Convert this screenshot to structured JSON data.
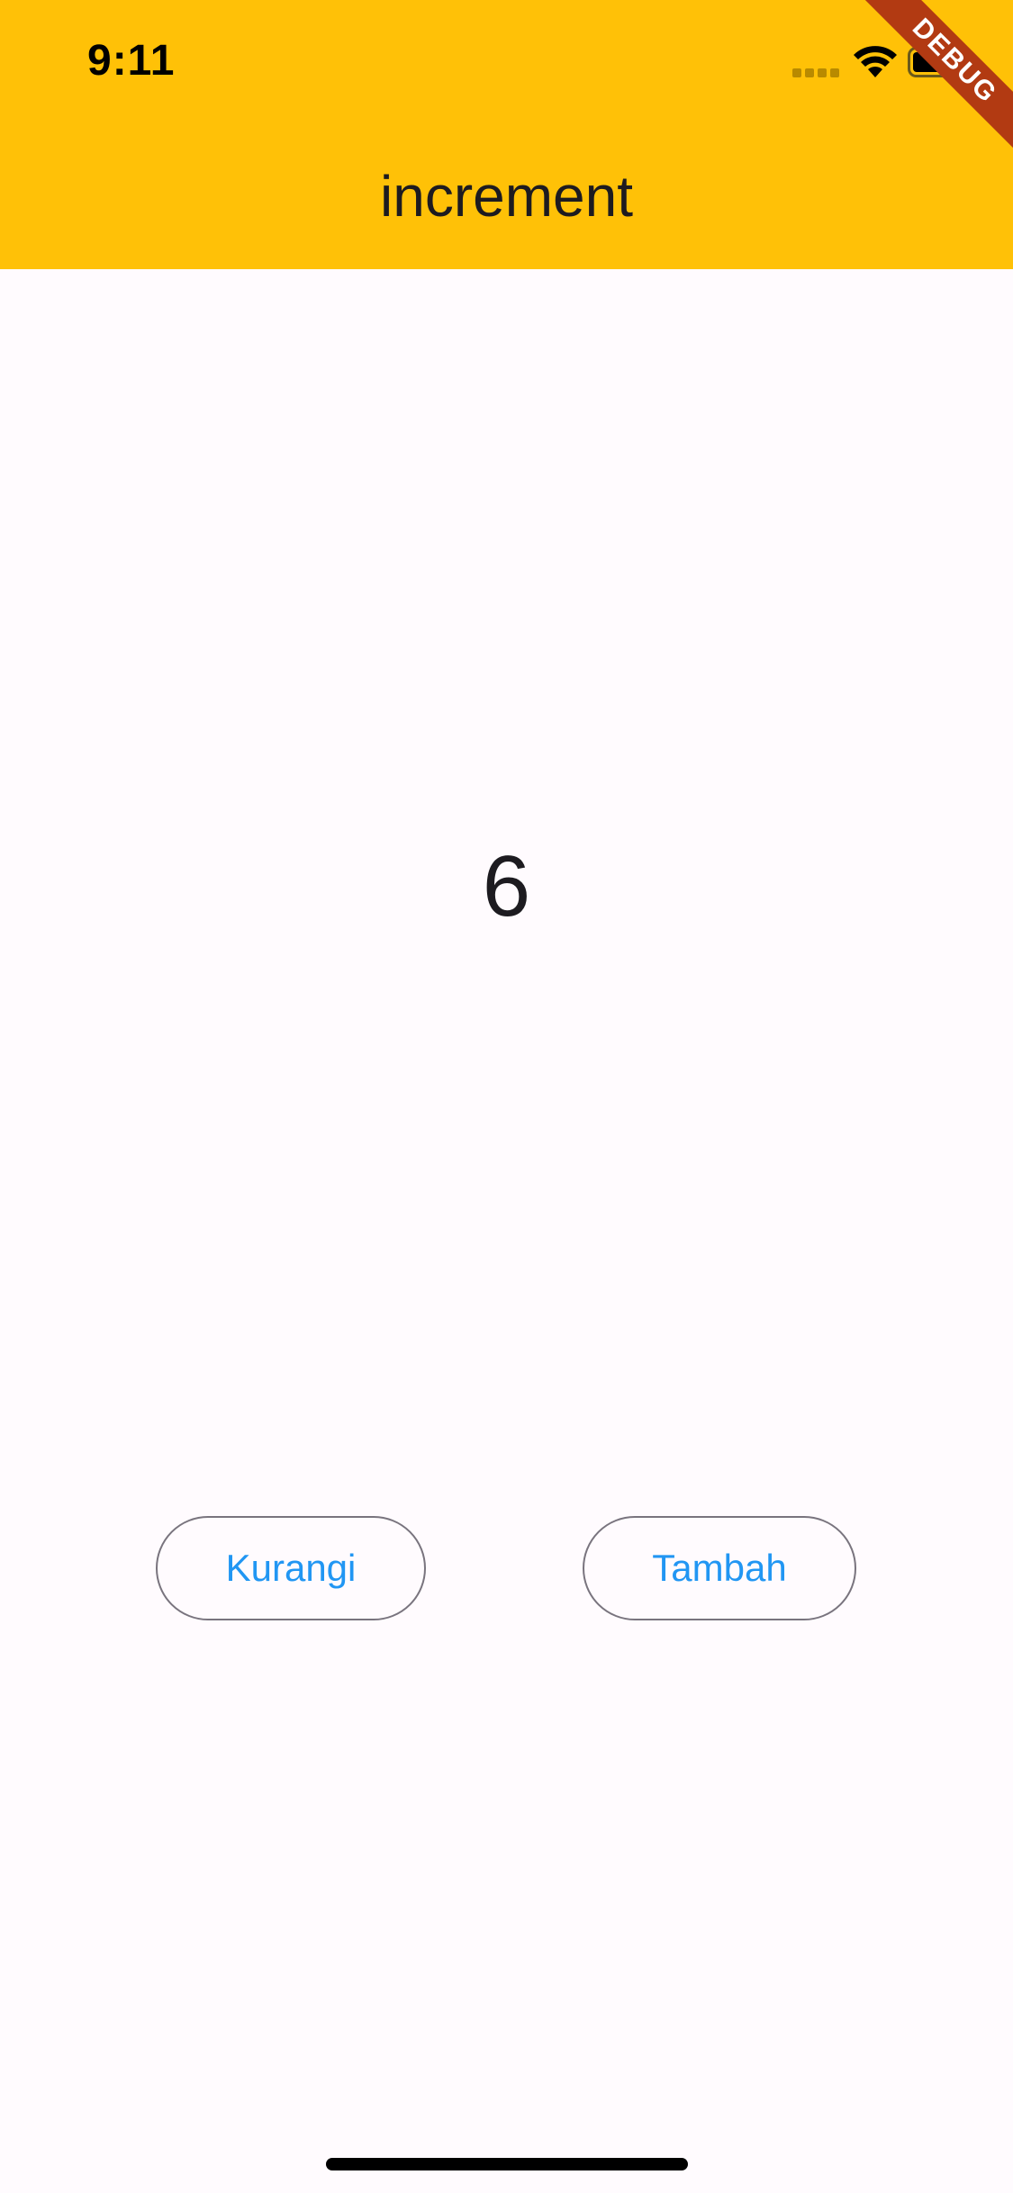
{
  "status_bar": {
    "time": "9:11",
    "icons": [
      "cellular-signal-icon",
      "wifi-icon",
      "battery-icon"
    ]
  },
  "app_bar": {
    "title": "increment",
    "background_color": "#ffc107"
  },
  "debug_banner": {
    "label": "DEBUG",
    "color": "#b23a12"
  },
  "counter": {
    "value": "6"
  },
  "buttons": {
    "decrement_label": "Kurangi",
    "increment_label": "Tambah",
    "text_color": "#2196f3",
    "border_color": "#79747e"
  },
  "colors": {
    "page_background": "#fffbfe",
    "text_primary": "#1d1b20"
  }
}
